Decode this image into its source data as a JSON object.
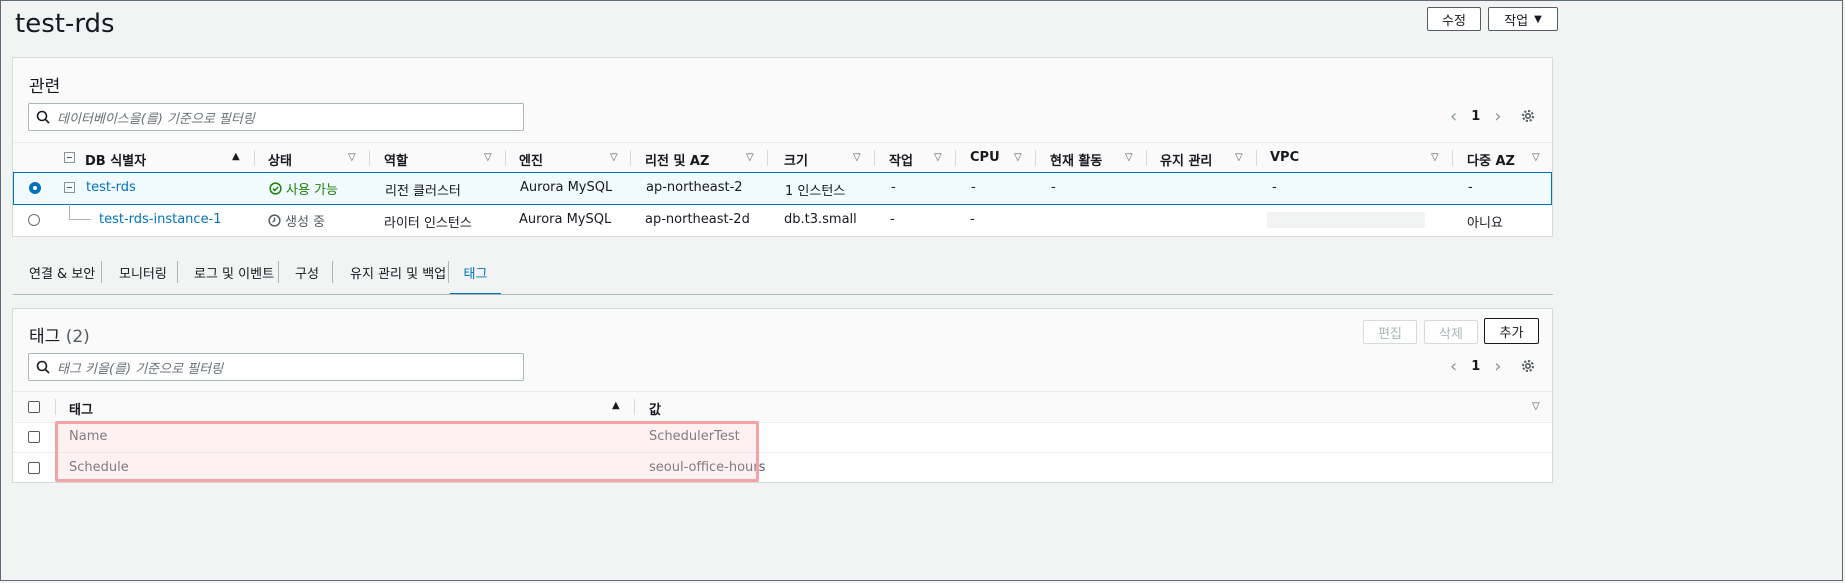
{
  "page": {
    "title": "test-rds"
  },
  "header_buttons": {
    "edit": "수정",
    "actions": "작업"
  },
  "related": {
    "title": "관련",
    "search_placeholder": "데이터베이스을(를) 기준으로 필터링",
    "page": "1",
    "columns": [
      "DB 식별자",
      "상태",
      "역할",
      "엔진",
      "리전 및 AZ",
      "크기",
      "작업",
      "CPU",
      "현재 활동",
      "유지 관리",
      "VPC",
      "다중 AZ"
    ],
    "rows": [
      {
        "id": "test-rds",
        "status": "사용 가능",
        "role": "리전 클러스터",
        "engine": "Aurora MySQL",
        "region": "ap-northeast-2",
        "size": "1 인스턴스",
        "action": "-",
        "cpu": "-",
        "activity": "-",
        "maintenance": "",
        "vpc": "-",
        "multi_az": "-"
      },
      {
        "id": "test-rds-instance-1",
        "status": "생성 중",
        "role": "라이터 인스턴스",
        "engine": "Aurora MySQL",
        "region": "ap-northeast-2d",
        "size": "db.t3.small",
        "action": "-",
        "cpu": "-",
        "activity": "",
        "maintenance": "",
        "vpc": "",
        "multi_az": "아니요"
      }
    ]
  },
  "tabs": [
    "연결 & 보안",
    "모니터링",
    "로그 및 이벤트",
    "구성",
    "유지 관리 및 백업",
    "태그"
  ],
  "tags": {
    "title": "태그",
    "count": "(2)",
    "buttons": {
      "edit": "편집",
      "delete": "삭제",
      "add": "추가"
    },
    "search_placeholder": "태그 키을(를) 기준으로 필터링",
    "page": "1",
    "columns": [
      "태그",
      "값"
    ],
    "rows": [
      {
        "key": "Name",
        "value": "SchedulerTest"
      },
      {
        "key": "Schedule",
        "value": "seoul-office-hours"
      }
    ]
  },
  "colors": {
    "accent": "#0073bb",
    "success": "#1d8102",
    "highlight": "#f5a3a8"
  }
}
